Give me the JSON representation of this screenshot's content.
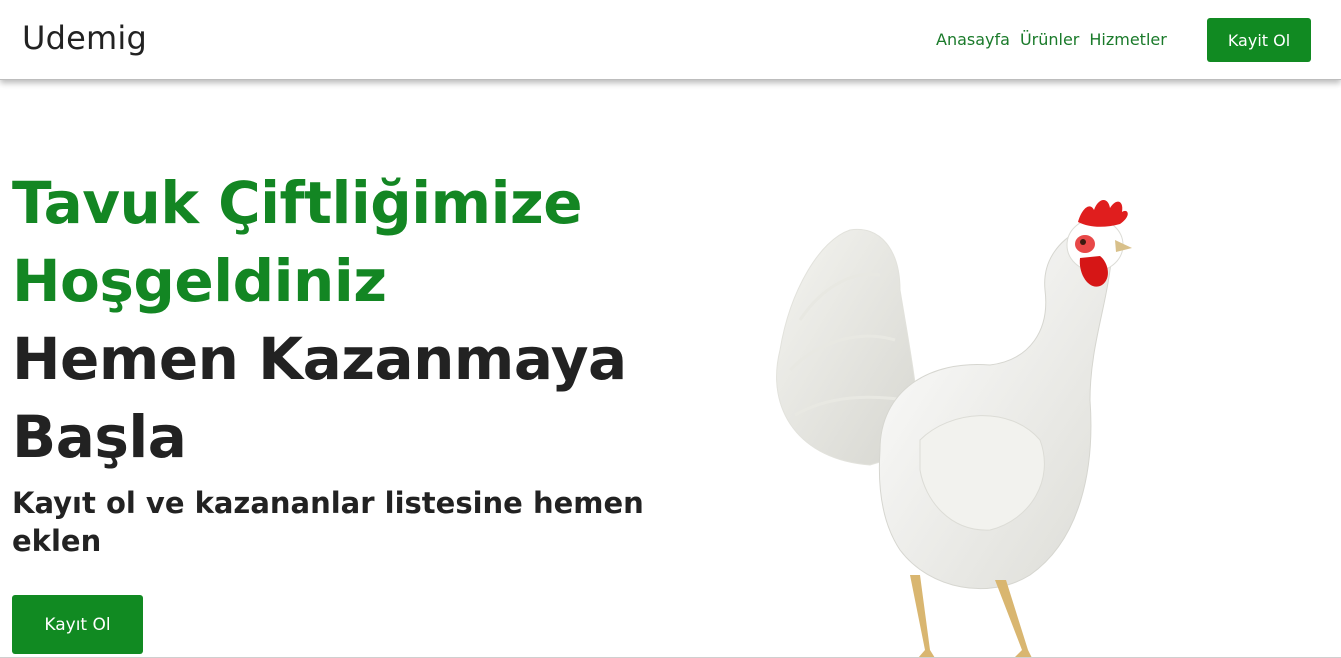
{
  "navbar": {
    "brand": "Udemig",
    "links": [
      "Anasayfa",
      "Ürünler",
      "Hizmetler"
    ],
    "cta_label": "Kayit Ol"
  },
  "hero": {
    "headline_green_1": "Tavuk Çiftliğimize",
    "headline_green_2": "Hoşgeldiniz",
    "headline_dark_1": "Hemen Kazanmaya",
    "headline_dark_2": "Başla",
    "subtitle": "Kayıt ol ve kazananlar listesine hemen eklen",
    "cta_label": "Kayıt Ol",
    "image": "white-hen-icon"
  },
  "colors": {
    "accent": "#118a22",
    "heading_green": "#138623",
    "text_dark": "#222222"
  }
}
